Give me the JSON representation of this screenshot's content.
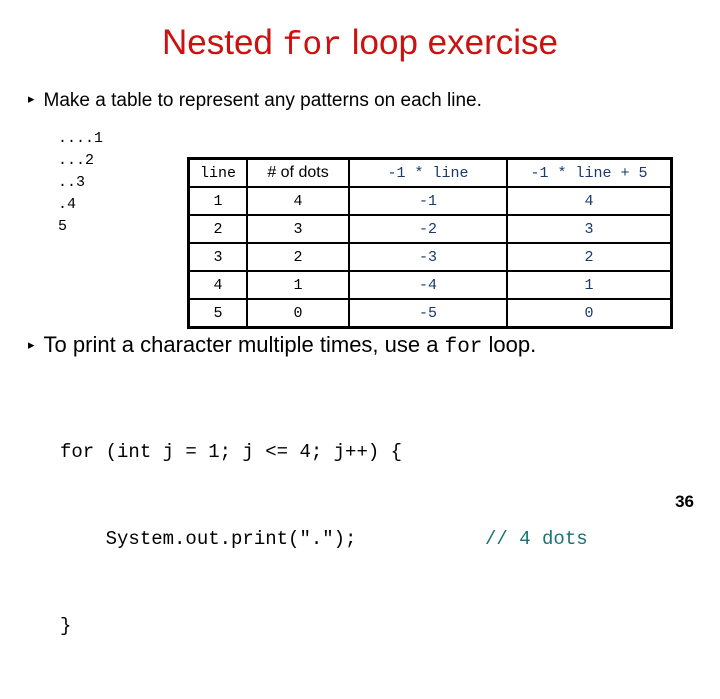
{
  "slide": {
    "title_pre": "Nested ",
    "title_mono": "for",
    "title_post": " loop exercise",
    "page_number": "36"
  },
  "bullets": [
    {
      "marker": "▸",
      "pre": "Make a table to represent any patterns on each line.",
      "mono": "",
      "post": ""
    },
    {
      "marker": "▸",
      "pre": "To print a character multiple times, use a ",
      "mono": "for",
      "post": " loop."
    }
  ],
  "dot_pattern": {
    "lines": [
      "....1",
      "...2",
      "..3",
      ".4",
      "5"
    ],
    "text": "....1\n...2\n..3\n.4\n5"
  },
  "table": {
    "headers": [
      {
        "label": "line",
        "style": "mono",
        "color": "#000000"
      },
      {
        "label": "# of dots",
        "style": "sans",
        "color": "#000000"
      },
      {
        "label": "-1 * line",
        "style": "mono",
        "color": "#1a3a6b"
      },
      {
        "label": "-1 * line + 5",
        "style": "mono",
        "color": "#1a3a6b"
      }
    ],
    "rows": [
      {
        "line": "1",
        "dots": "4",
        "expr": "-1",
        "expr5": "4"
      },
      {
        "line": "2",
        "dots": "3",
        "expr": "-2",
        "expr5": "3"
      },
      {
        "line": "3",
        "dots": "2",
        "expr": "-3",
        "expr5": "2"
      },
      {
        "line": "4",
        "dots": "1",
        "expr": "-4",
        "expr5": "1"
      },
      {
        "line": "5",
        "dots": "0",
        "expr": "-5",
        "expr5": "0"
      }
    ]
  },
  "code": {
    "line1": "for (int j = 1; j <= 4; j++) {",
    "line2": "    System.out.print(\".\");",
    "line2_comment": "// 4 dots",
    "line3": "}"
  },
  "colors": {
    "title_red": "#cc1111",
    "expr_blue": "#1a3a6b",
    "comment_teal": "#1a7272",
    "text_black": "#000000",
    "background": "#ffffff"
  }
}
